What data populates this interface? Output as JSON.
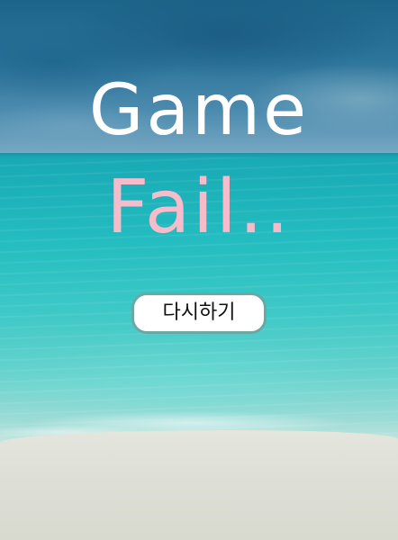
{
  "screen": {
    "title_line1": "Game",
    "title_line2": "Fail..",
    "retry_label": "다시하기"
  },
  "colors": {
    "title_line1": "#ffffff",
    "title_line2": "#f7bccb",
    "button_background": "#ffffff",
    "button_border": "#6aa9a3"
  }
}
